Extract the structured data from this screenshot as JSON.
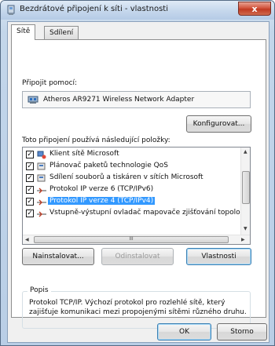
{
  "window": {
    "title": "Bezdrátové připojení k síti - vlastnosti",
    "close_label": "x"
  },
  "tabs": [
    {
      "label": "Sítě",
      "active": true
    },
    {
      "label": "Sdílení",
      "active": false
    }
  ],
  "connect_using": {
    "label": "Připojit pomocí:",
    "adapter": "Atheros AR9271 Wireless Network Adapter",
    "configure_label": "Konfigurovat..."
  },
  "items_section": {
    "label": "Toto připojení používá následující položky:",
    "items": [
      {
        "label": "Klient sítě Microsoft",
        "checked": true,
        "icon": "network-client-icon"
      },
      {
        "label": "Plánovač paketů technologie QoS",
        "checked": true,
        "icon": "qos-scheduler-icon"
      },
      {
        "label": "Sdílení souborů a tiskáren v sítích Microsoft",
        "checked": true,
        "icon": "file-printer-sharing-icon"
      },
      {
        "label": "Protokol IP verze 6 (TCP/IPv6)",
        "checked": true,
        "icon": "protocol-icon"
      },
      {
        "label": "Protokol IP verze 4 (TCP/IPv4)",
        "checked": true,
        "icon": "protocol-icon",
        "selected": true
      },
      {
        "label": "Vstupně-výstupní ovladač mapovače zjišťování topolo",
        "checked": true,
        "icon": "protocol-icon"
      }
    ],
    "check_glyph": "✓",
    "hscroll_grip": "III"
  },
  "actions": {
    "install_label": "Nainstalovat...",
    "uninstall_label": "Odinstalovat",
    "properties_label": "Vlastnosti"
  },
  "description": {
    "title": "Popis",
    "text": "Protokol TCP/IP. Výchozí protokol pro rozlehlé sítě, který zajišťuje komunikaci mezi propojenými sítěmi různého druhu."
  },
  "footer": {
    "ok_label": "OK",
    "cancel_label": "Storno"
  },
  "colors": {
    "selection": "#3399ff",
    "close_button": "#c03a22"
  }
}
